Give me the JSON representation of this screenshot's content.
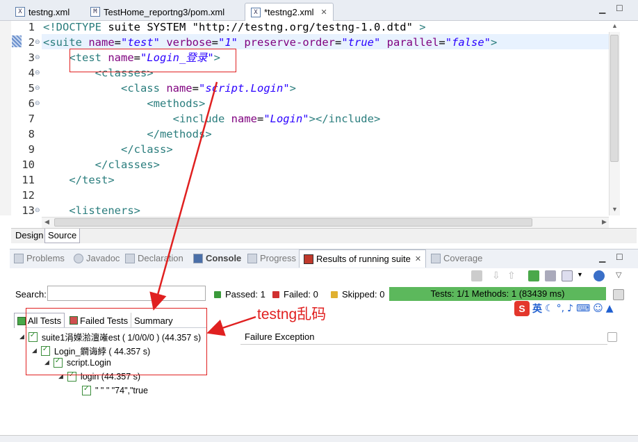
{
  "editor_tabs": [
    {
      "label": "testng.xml",
      "icon": "xml-file-icon"
    },
    {
      "label": "TestHome_reportng3/pom.xml",
      "icon": "maven-file-icon"
    },
    {
      "label": "*testng2.xml",
      "icon": "xml-file-icon",
      "active": true
    }
  ],
  "code": {
    "line_numbers": [
      "1",
      "2",
      "3",
      "4",
      "5",
      "6",
      "7",
      "8",
      "9",
      "10",
      "11",
      "12",
      "13"
    ],
    "lines": [
      "<!DOCTYPE suite SYSTEM \"http://testng.org/testng-1.0.dtd\" >",
      "<suite name=\"test\" verbose=\"1\" preserve-order=\"true\" parallel=\"false\">",
      "    <test name=\"Login_登录\">",
      "        <classes>",
      "            <class name=\"script.Login\">",
      "                <methods>",
      "                    <include name=\"Login\"></include>",
      "                </methods>",
      "            </class>",
      "        </classes>",
      "    </test>",
      "",
      "    <listeners>"
    ]
  },
  "design_source_tabs": {
    "design": "Design",
    "source": "Source"
  },
  "view_tabs": [
    {
      "label": "Problems"
    },
    {
      "label": "Javadoc"
    },
    {
      "label": "Declaration"
    },
    {
      "label": "Console"
    },
    {
      "label": "Progress"
    },
    {
      "label": "Results of running suite"
    },
    {
      "label": "Coverage"
    }
  ],
  "search": {
    "label": "Search:",
    "value": ""
  },
  "stats": {
    "passed": "Passed: 1",
    "failed": "Failed: 0",
    "skipped": "Skipped: 0",
    "progress": "Tests: 1/1  Methods: 1 (83439 ms)",
    "progress_fraction": 1.0
  },
  "tree_tabs": [
    "All Tests",
    "Failed Tests",
    "Summary"
  ],
  "tree": [
    {
      "label": "suite1涓嬫湁澶嶉est ( 1/0/0/0 ) (44.357 s)"
    },
    {
      "label": "Login_鐧诲綍 ( 44.357 s)"
    },
    {
      "label": "script.Login"
    },
    {
      "label": "login  (44.357 s)"
    },
    {
      "label": "\"                 \"    \"     \"74\",\"true"
    }
  ],
  "failure_header": "Failure Exception",
  "annotation": "testng乱码",
  "ime": {
    "mode": "英"
  },
  "colors": {
    "progress_green": "#5cb85c",
    "annotation_red": "#e02020"
  }
}
